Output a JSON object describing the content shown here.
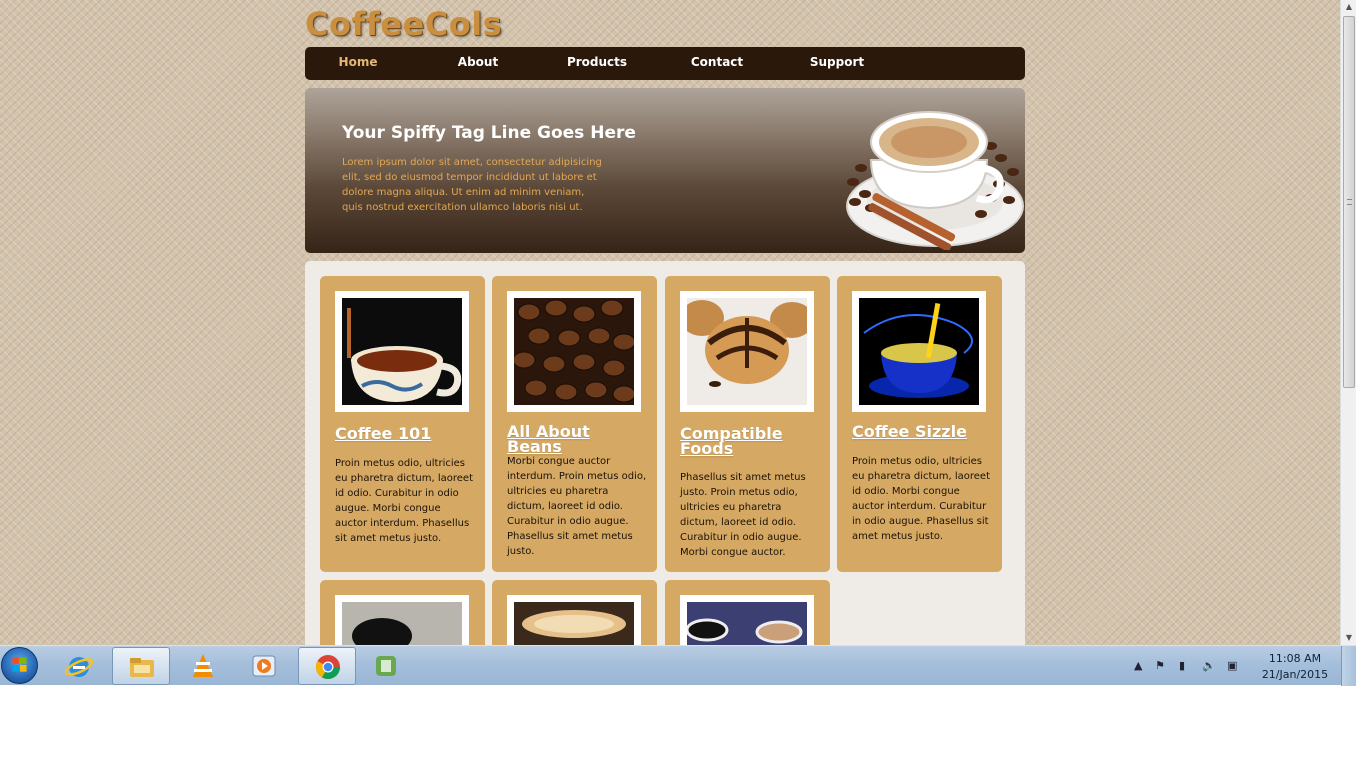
{
  "site": {
    "logo": "CoffeeCols",
    "nav": [
      {
        "label": "Home",
        "active": true
      },
      {
        "label": "About",
        "active": false
      },
      {
        "label": "Products",
        "active": false
      },
      {
        "label": "Contact",
        "active": false
      },
      {
        "label": "Support",
        "active": false
      }
    ],
    "banner": {
      "tagline": "Your Spiffy Tag Line Goes Here",
      "text": "Lorem ipsum dolor sit amet, consectetur adipisicing elit, sed do eiusmod tempor incididunt ut labore et dolore magna aliqua. Ut enim ad minim veniam, quis nostrud exercitation ullamco laboris nisi ut."
    },
    "cards": [
      {
        "title": "Coffee 101",
        "text": "Proin metus odio, ultricies eu pharetra dictum, laoreet id odio. Curabitur in odio augue. Morbi congue auctor interdum. Phasellus sit amet metus justo."
      },
      {
        "title": "All About Beans",
        "text": "Morbi congue auctor interdum. Proin metus odio, ultricies eu pharetra dictum, laoreet id odio. Curabitur in odio augue. Phasellus sit amet metus justo."
      },
      {
        "title": "Compatible Foods",
        "text": "Phasellus sit amet metus justo. Proin metus odio, ultricies eu pharetra dictum, laoreet id odio. Curabitur in odio augue. Morbi congue auctor."
      },
      {
        "title": "Coffee Sizzle",
        "text": "Proin metus odio, ultricies eu pharetra dictum, laoreet id odio. Morbi congue auctor interdum. Curabitur in odio augue. Phasellus sit amet metus justo."
      }
    ]
  },
  "colors": {
    "nav_bg": "#2a180b",
    "nav_active": "#e5b777",
    "card_bg": "#d5a863",
    "content_bg": "#efebe6",
    "banner_text": "#e3a852"
  },
  "taskbar": {
    "items": [
      "windows-start-icon",
      "internet-explorer-icon",
      "file-explorer-icon",
      "vlc-icon",
      "media-player-icon",
      "chrome-icon",
      "camtasia-icon"
    ],
    "clock_time": "11:08 AM",
    "clock_date": "21/Jan/2015"
  }
}
